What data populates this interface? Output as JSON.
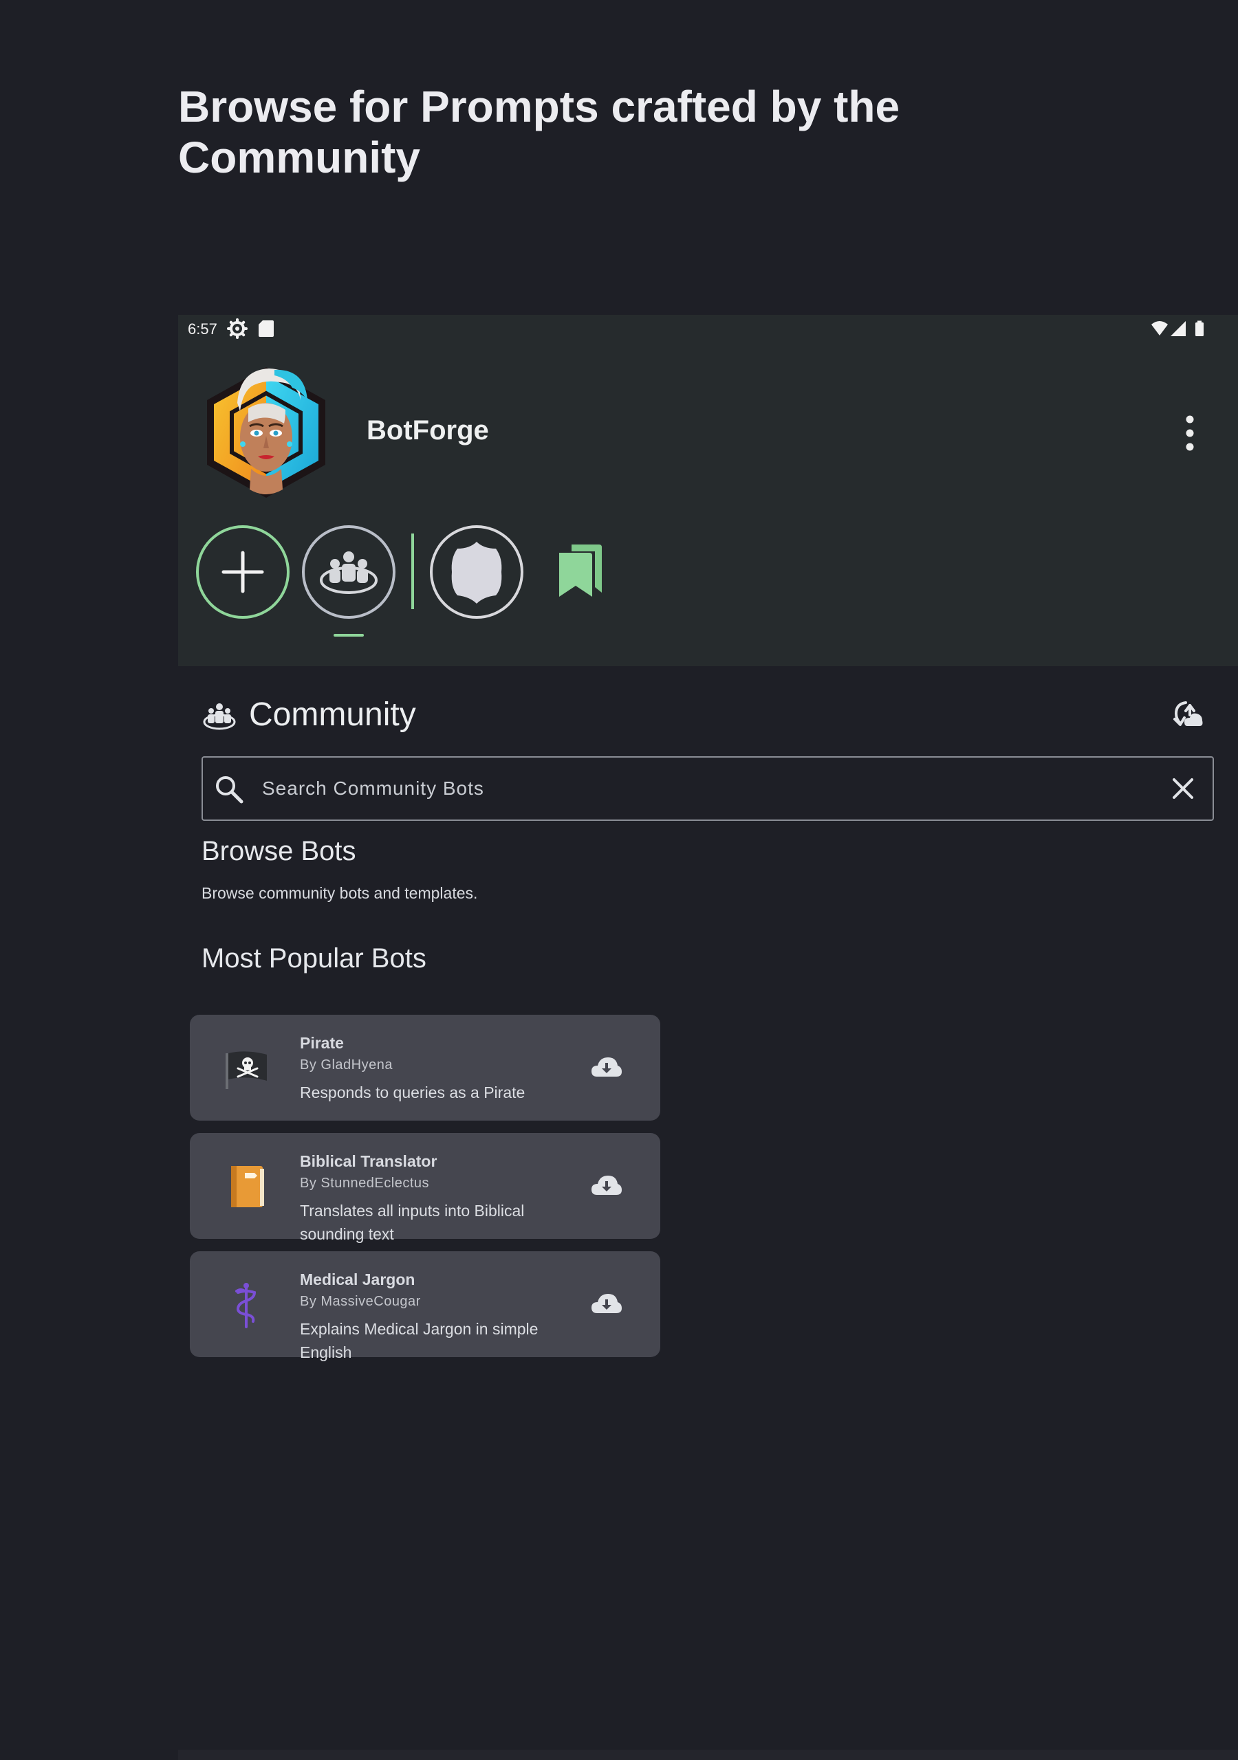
{
  "promo": {
    "heading": "Browse for Prompts crafted by the Community"
  },
  "status_bar": {
    "time": "6:57",
    "icons": [
      "settings-gear-icon",
      "sd-card-icon",
      "wifi-icon",
      "cell-signal-icon",
      "battery-icon"
    ]
  },
  "app": {
    "title": "BotForge",
    "avatar": "avatar-icon",
    "menu_icon": "more-vert-icon"
  },
  "nav": {
    "items": [
      {
        "icon": "add-icon"
      },
      {
        "icon": "community-icon"
      },
      {
        "icon": "my-bots-icon"
      },
      {
        "icon": "bookmarks-icon"
      }
    ]
  },
  "community": {
    "title": "Community",
    "section_icon": "community-icon",
    "sync_icon": "cloud-sync-icon"
  },
  "search": {
    "placeholder": "Search Community Bots",
    "value": "",
    "search_icon": "search-icon",
    "clear_icon": "close-icon"
  },
  "browse": {
    "title": "Browse Bots",
    "subtitle": "Browse community bots and templates."
  },
  "popular": {
    "title": "Most Popular Bots",
    "bots": [
      {
        "name": "Pirate",
        "author": "By GladHyena",
        "description": "Responds to queries as a Pirate",
        "icon": "pirate-flag-icon"
      },
      {
        "name": "Biblical Translator",
        "author": "By StunnedEclectus",
        "description": "Translates all inputs into Biblical sounding text",
        "icon": "book-icon"
      },
      {
        "name": "Medical Jargon",
        "author": "By MassiveCougar",
        "description": "Explains Medical Jargon in simple English",
        "icon": "caduceus-icon"
      }
    ]
  },
  "colors": {
    "background": "#1e1f26",
    "panel": "#262b2d",
    "accent": "#8fd69a",
    "card": "#45464f"
  }
}
